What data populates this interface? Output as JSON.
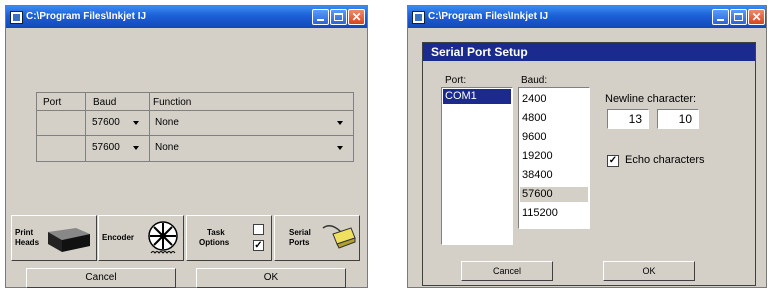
{
  "left_window": {
    "title": "C:\\Program Files\\Inkjet   IJ",
    "ports_table": {
      "headers": [
        "Port",
        "Baud",
        "Function"
      ],
      "rows": [
        {
          "port": "",
          "baud": "57600",
          "function": "None"
        },
        {
          "port": "",
          "baud": "57600",
          "function": "None"
        }
      ]
    },
    "toolbar": {
      "print_heads_label_1": "Print",
      "print_heads_label_2": "Heads",
      "encoder_label": "Encoder",
      "task_options_label_1": "Task",
      "task_options_label_2": "Options",
      "serial_ports_label_1": "Serial",
      "serial_ports_label_2": "Ports"
    },
    "cancel_label": "Cancel",
    "ok_label": "OK"
  },
  "right_window": {
    "title": "C:\\Program Files\\Inkjet   IJ",
    "dialog_title": "Serial Port Setup",
    "port_label": "Port:",
    "port_items": [
      "COM1"
    ],
    "baud_label": "Baud:",
    "baud_items": [
      "2400",
      "4800",
      "9600",
      "19200",
      "38400",
      "57600",
      "115200"
    ],
    "newline_label": "Newline character:",
    "newline_value_1": "13",
    "newline_value_2": "10",
    "echo_label": "Echo characters",
    "echo_checked": true,
    "cancel_label": "Cancel",
    "ok_label": "OK"
  },
  "colors": {
    "title_blue": "#1c5fd8",
    "selection": "#1b2a8c",
    "face": "#d4d0c8"
  }
}
